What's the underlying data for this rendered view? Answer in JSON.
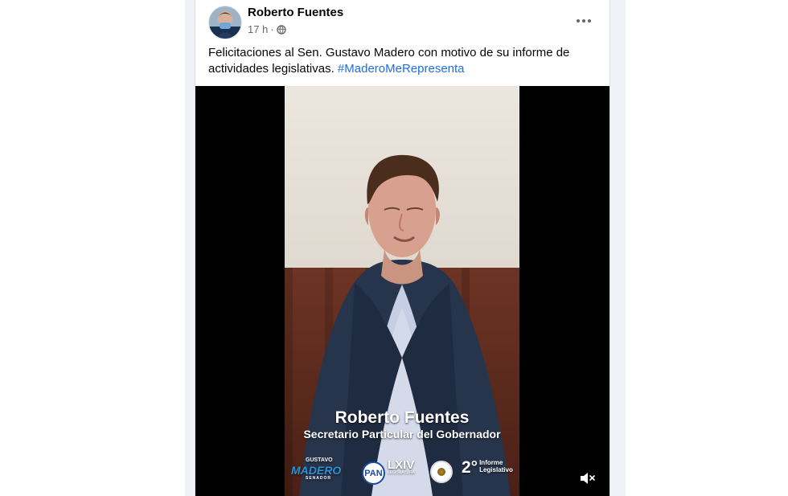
{
  "post": {
    "author": "Roberto Fuentes",
    "time": "17 h",
    "separator": "·",
    "text_before_hashtag": "Felicitaciones al Sen. Gustavo Madero con motivo de su informe de actividades legislativas. ",
    "hashtag": "#MaderoMeRepresenta"
  },
  "video": {
    "caption_name": "Roberto Fuentes",
    "caption_role": "Secretario Particular del Gobernador",
    "logos": {
      "madero_top": "GUSTAVO",
      "madero_main": "MADERO",
      "madero_bottom": "SENADOR",
      "pan": "PAN",
      "lxiv": "LXIV",
      "lxiv_small": "LEGISLATURA",
      "informe_number": "2°",
      "informe_line1": "Informe",
      "informe_line2": "Legislativo"
    }
  },
  "colors": {
    "feed_background": "#f0f2f5",
    "card_background": "#ffffff",
    "text_primary": "#050505",
    "text_secondary": "#65676b",
    "hashtag": "#216fdb",
    "video_background": "#000000"
  },
  "icons": {
    "audience": "globe-icon",
    "menu": "more-options-icon",
    "mute": "muted-volume-icon"
  }
}
